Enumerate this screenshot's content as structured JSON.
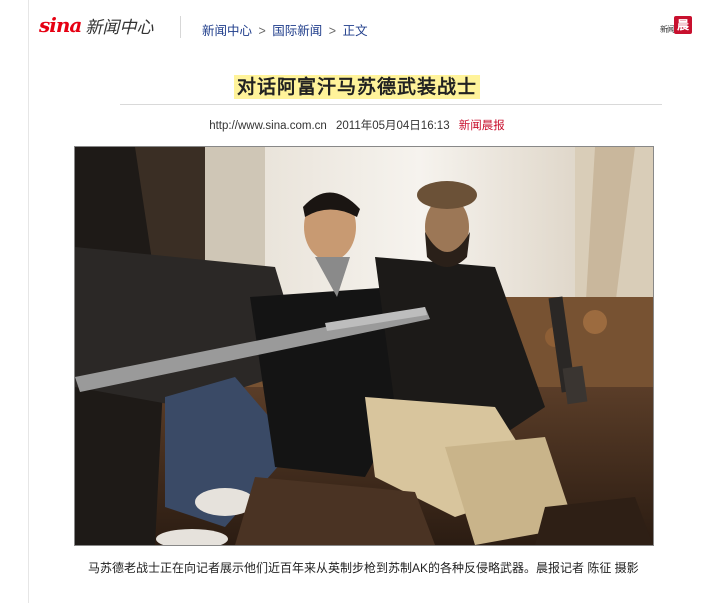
{
  "header": {
    "logo_brand": "sina",
    "logo_section": "新闻中心",
    "breadcrumb": [
      "新闻中心",
      "国际新闻",
      "正文"
    ],
    "breadcrumb_sep": ">",
    "badge_text": "新闻",
    "badge_char": "晨"
  },
  "article": {
    "title": "对话阿富汗马苏德武装战士",
    "url": "http://www.sina.com.cn",
    "datetime": "2011年05月04日16:13",
    "source": "新闻晨报",
    "caption": "马苏德老战士正在向记者展示他们近百年来从英制步枪到苏制AK的各种反侵略武器。晨报记者 陈征 摄影"
  },
  "photo": {
    "description_icon": "photo-image"
  },
  "colors": {
    "brand_red": "#e60012",
    "title_highlight": "#fff39a",
    "link_blue": "#1f3d8b"
  }
}
